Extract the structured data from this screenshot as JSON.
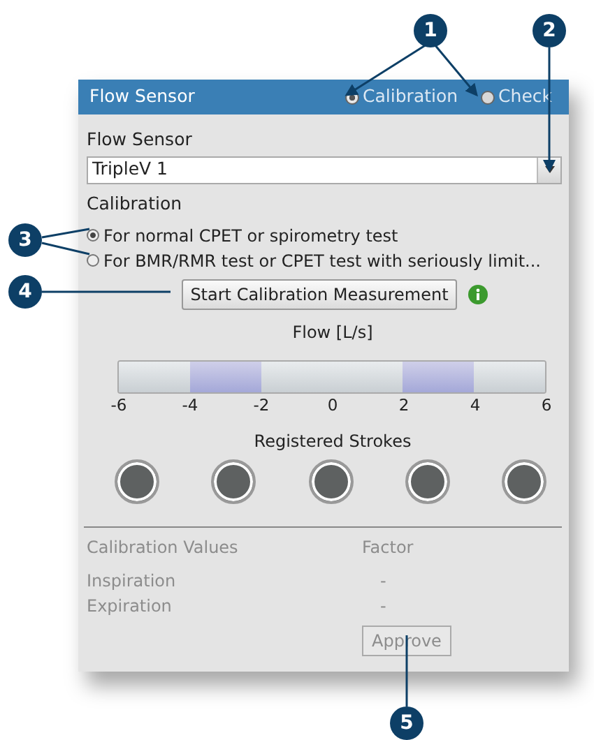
{
  "window": {
    "title": "Flow Sensor",
    "modes": [
      {
        "label": "Calibration",
        "selected": true
      },
      {
        "label": "Check",
        "selected": false
      }
    ]
  },
  "sensor": {
    "label": "Flow Sensor",
    "value": "TripleV 1"
  },
  "calibration": {
    "label": "Calibration",
    "options": [
      {
        "label": "For normal CPET or spirometry test",
        "selected": true
      },
      {
        "label": "For BMR/RMR test or CPET test with seriously limit...",
        "selected": false
      }
    ]
  },
  "start_button": {
    "label": "Start Calibration Measurement"
  },
  "flow": {
    "title": "Flow [L/s]",
    "segments": [
      {
        "highlighted": false
      },
      {
        "highlighted": true
      },
      {
        "highlighted": false
      },
      {
        "highlighted": false
      },
      {
        "highlighted": true
      },
      {
        "highlighted": false
      }
    ],
    "ticks": [
      "-6",
      "-4",
      "-2",
      "0",
      "2",
      "4",
      "6"
    ]
  },
  "strokes": {
    "title": "Registered Strokes",
    "items": [
      {
        "registered": false
      },
      {
        "registered": false
      },
      {
        "registered": false
      },
      {
        "registered": false
      },
      {
        "registered": false
      }
    ]
  },
  "calibration_values": {
    "disabled": true,
    "columns": [
      "Calibration Values",
      "Factor"
    ],
    "rows": [
      {
        "name": "Inspiration",
        "factor": "-"
      },
      {
        "name": "Expiration",
        "factor": "-"
      }
    ]
  },
  "approve_button": {
    "label": "Approve",
    "disabled": true
  },
  "callouts": [
    {
      "number": "1"
    },
    {
      "number": "2"
    },
    {
      "number": "3"
    },
    {
      "number": "4"
    },
    {
      "number": "5"
    }
  ]
}
